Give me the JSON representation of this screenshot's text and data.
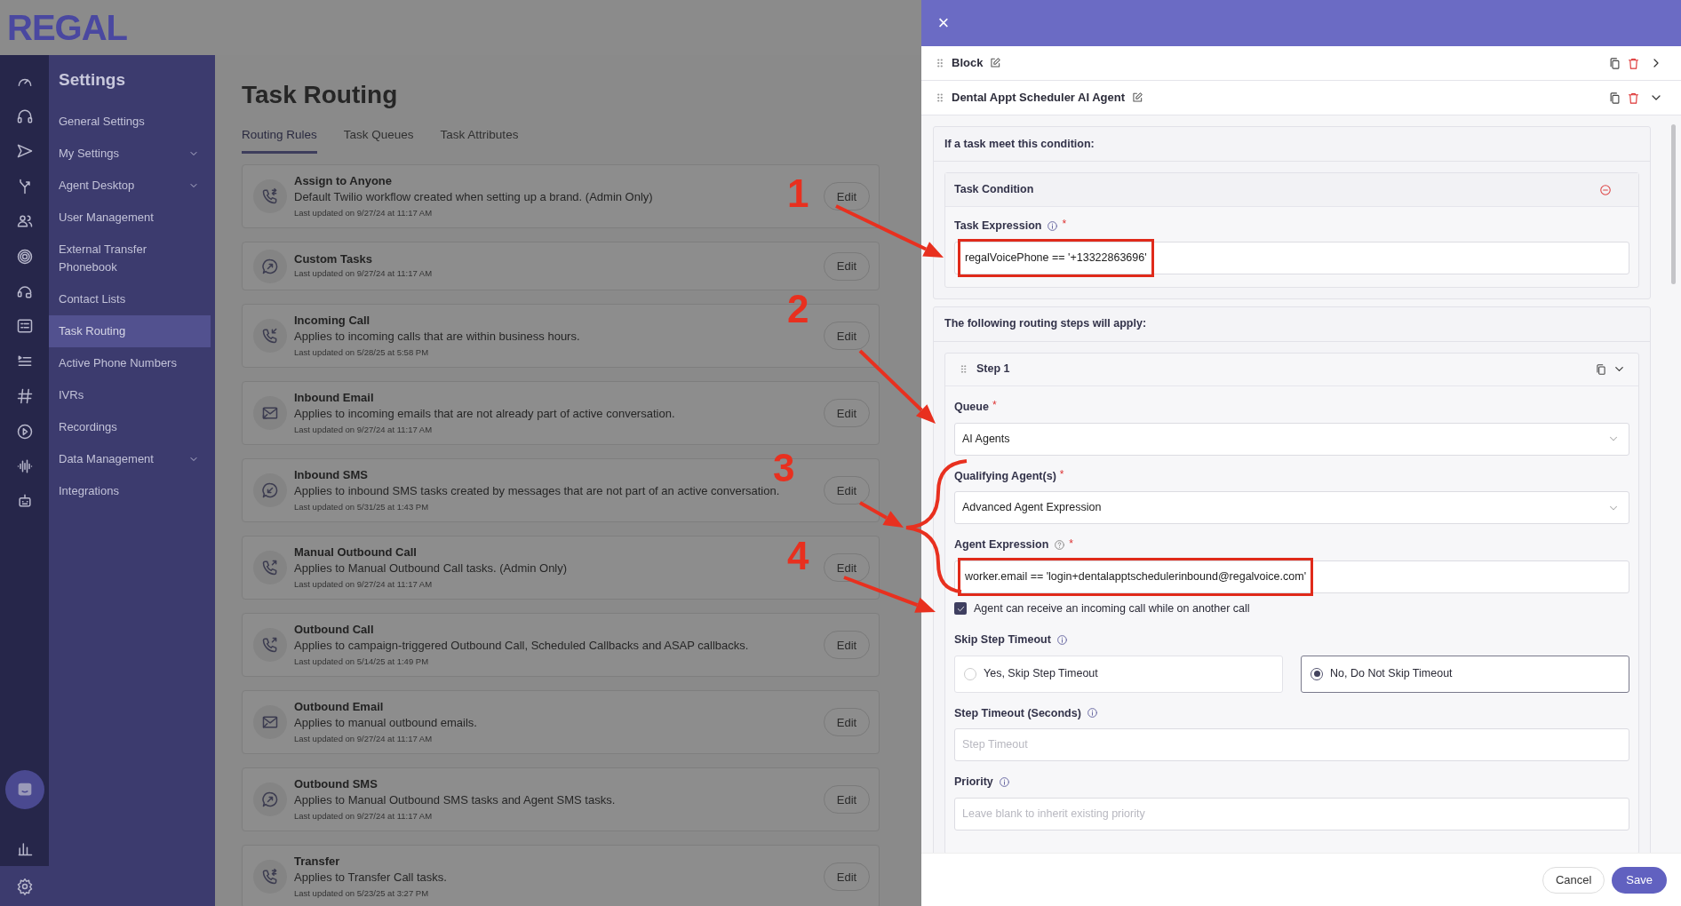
{
  "logo": "REGAL",
  "settings_nav": {
    "title": "Settings",
    "items": [
      {
        "label": "General Settings",
        "kind": "link",
        "selected": false
      },
      {
        "label": "My Settings",
        "kind": "group",
        "selected": false
      },
      {
        "label": "Agent Desktop",
        "kind": "group",
        "selected": false
      },
      {
        "label": "User Management",
        "kind": "link",
        "selected": false
      },
      {
        "label": "External Transfer Phonebook",
        "kind": "link",
        "selected": false
      },
      {
        "label": "Contact Lists",
        "kind": "link",
        "selected": false
      },
      {
        "label": "Task Routing",
        "kind": "link",
        "selected": true
      },
      {
        "label": "Active Phone Numbers",
        "kind": "link",
        "selected": false
      },
      {
        "label": "IVRs",
        "kind": "link",
        "selected": false
      },
      {
        "label": "Recordings",
        "kind": "link",
        "selected": false
      },
      {
        "label": "Data Management",
        "kind": "group",
        "selected": false
      },
      {
        "label": "Integrations",
        "kind": "link",
        "selected": false
      }
    ]
  },
  "page": {
    "title": "Task Routing",
    "tabs": [
      {
        "label": "Routing Rules",
        "selected": true
      },
      {
        "label": "Task Queues",
        "selected": false
      },
      {
        "label": "Task Attributes",
        "selected": false
      }
    ],
    "rules": [
      {
        "name": "Assign to Anyone",
        "description": "Default Twilio workflow created when setting up a brand. (Admin Only)",
        "updated": "Last updated on 9/27/24 at 11:17 AM",
        "action": "Edit"
      },
      {
        "name": "Custom Tasks",
        "updated": "Last updated on 9/27/24 at 11:17 AM",
        "action": "Edit"
      },
      {
        "name": "Incoming Call",
        "description": "Applies to incoming calls that are within business hours.",
        "updated": "Last updated on 5/28/25 at 5:58 PM",
        "action": "Edit"
      },
      {
        "name": "Inbound Email",
        "description": "Applies to incoming emails that are not already part of active conversation.",
        "updated": "Last updated on 9/27/24 at 11:17 AM",
        "action": "Edit"
      },
      {
        "name": "Inbound SMS",
        "description": "Applies to inbound SMS tasks created by messages that are not part of an active conversation.",
        "updated": "Last updated on 5/31/25 at 1:43 PM",
        "action": "Edit"
      },
      {
        "name": "Manual Outbound Call",
        "description": "Applies to Manual Outbound Call tasks. (Admin Only)",
        "updated": "Last updated on 9/27/24 at 11:17 AM",
        "action": "Edit"
      },
      {
        "name": "Outbound Call",
        "description": "Applies to campaign-triggered Outbound Call, Scheduled Callbacks and ASAP callbacks.",
        "updated": "Last updated on 5/14/25 at 1:49 PM",
        "action": "Edit"
      },
      {
        "name": "Outbound Email",
        "description": "Applies to manual outbound emails.",
        "updated": "Last updated on 9/27/24 at 11:17 AM",
        "action": "Edit"
      },
      {
        "name": "Outbound SMS",
        "description": "Applies to Manual Outbound SMS tasks and Agent SMS tasks.",
        "updated": "Last updated on 9/27/24 at 11:17 AM",
        "action": "Edit"
      },
      {
        "name": "Transfer",
        "description": "Applies to Transfer Call tasks.",
        "updated": "Last updated on 5/23/25 at 3:27 PM",
        "action": "Edit"
      }
    ]
  },
  "drawer": {
    "close": "×",
    "blocks": [
      {
        "title": "Block",
        "expanded": false
      },
      {
        "title": "Dental Appt Scheduler AI Agent",
        "expanded": true
      }
    ],
    "condition_section": {
      "heading": "If a task meet this condition:",
      "condition_title": "Task Condition",
      "field": {
        "label": "Task Expression",
        "required_mark": "*",
        "value": "regalVoicePhone == '+13322863696'",
        "highlighted": true
      }
    },
    "steps_section": {
      "heading": "The following routing steps will apply:",
      "step": {
        "title": "Step 1",
        "expanded": true,
        "fields": [
          {
            "kind": "select",
            "label": "Queue",
            "required_mark": "*",
            "value": "AI Agents",
            "highlighted": false
          },
          {
            "kind": "select",
            "label": "Qualifying Agent(s)",
            "required_mark": "*",
            "value": "Advanced Agent Expression",
            "highlighted": false
          },
          {
            "kind": "text",
            "label": "Agent Expression",
            "required_mark": "*",
            "value": "worker.email == 'login+dentalapptschedulerinbound@regalvoice.com'",
            "highlighted": true
          },
          {
            "kind": "checkbox",
            "label": "Agent can receive an incoming call while on another call",
            "checked": true
          },
          {
            "kind": "radio",
            "label": "Skip Step Timeout",
            "options": [
              {
                "label": "Yes, Skip Step Timeout",
                "selected": false
              },
              {
                "label": "No, Do Not Skip Timeout",
                "selected": true
              }
            ]
          },
          {
            "kind": "text",
            "label": "Step Timeout (Seconds)",
            "placeholder": "Step Timeout"
          },
          {
            "kind": "text",
            "label": "Priority",
            "placeholder": "Leave blank to inherit existing priority"
          }
        ]
      }
    },
    "buttons": [
      {
        "label": "Cancel",
        "kind": "secondary"
      },
      {
        "label": "Save",
        "kind": "primary"
      }
    ]
  },
  "annotations": [
    {
      "label": "1"
    },
    {
      "label": "2"
    },
    {
      "label": "3"
    },
    {
      "label": "4"
    }
  ]
}
